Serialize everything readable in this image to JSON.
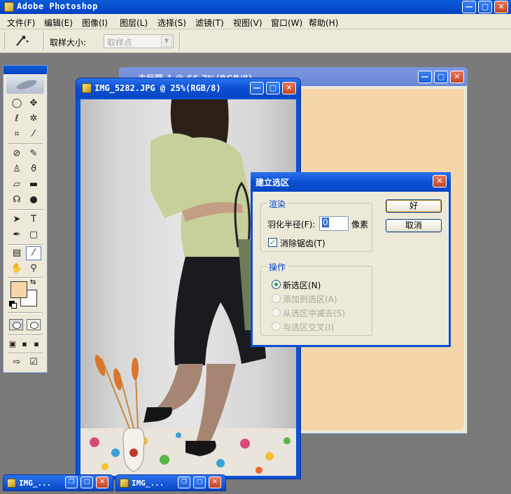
{
  "app": {
    "title": "Adobe Photoshop"
  },
  "menu": [
    "文件(F)",
    "编辑(E)",
    "图像(I)",
    "图层(L)",
    "选择(S)",
    "滤镜(T)",
    "视图(V)",
    "窗口(W)",
    "帮助(H)"
  ],
  "options": {
    "sample_size_label": "取样大小:",
    "sample_size_value": "取样点"
  },
  "windows": {
    "back_doc_title": "未标题-1 @ 66.7%(RGB/8)",
    "front_doc_title": "IMG_5282.JPG @ 25%(RGB/8)"
  },
  "colors": {
    "foreground": "#f8d5a8",
    "background": "#ffffff",
    "canvas": "#f6d6a9",
    "xp_blue": "#0a4fd3"
  },
  "dialog": {
    "title": "建立选区",
    "render_group": "渲染",
    "feather_label": "羽化半径(F):",
    "feather_value": "0",
    "feather_unit": "像素",
    "antialias_label": "消除锯齿(T)",
    "antialias_checked": true,
    "operation_group": "操作",
    "operations": [
      {
        "label": "新选区(N)",
        "checked": true,
        "enabled": true
      },
      {
        "label": "添加到选区(A)",
        "checked": false,
        "enabled": false
      },
      {
        "label": "从选区中减去(S)",
        "checked": false,
        "enabled": false
      },
      {
        "label": "与选区交叉(I)",
        "checked": false,
        "enabled": false
      }
    ],
    "ok_label": "好",
    "cancel_label": "取消"
  },
  "minimized": [
    "IMG_...",
    "IMG_..."
  ]
}
